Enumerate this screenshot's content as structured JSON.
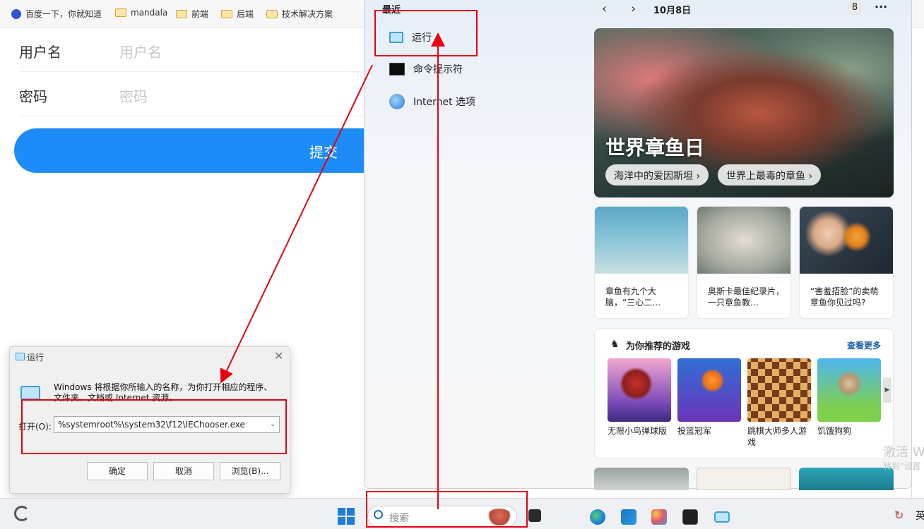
{
  "bookmarks": [
    {
      "label": "百度一下，你就知道",
      "icon": "baidu-paw-icon"
    },
    {
      "label": "mandala",
      "icon": "folder-icon"
    },
    {
      "label": "前端",
      "icon": "folder-icon"
    },
    {
      "label": "后端",
      "icon": "folder-icon"
    },
    {
      "label": "技术解决方案",
      "icon": "folder-icon"
    }
  ],
  "login_form": {
    "username_label": "用户名",
    "username_placeholder": "用户名",
    "password_label": "密码",
    "password_placeholder": "密码",
    "submit_label": "提交",
    "submit_color": "#1e8cf8"
  },
  "start_panel": {
    "recent_title": "最近",
    "recent_items": [
      {
        "label": "运行",
        "icon": "run-icon"
      },
      {
        "label": "命令提示符",
        "icon": "cmd-icon"
      },
      {
        "label": "Internet 选项",
        "icon": "internet-options-icon"
      }
    ],
    "date": "10月8日",
    "badge": "8",
    "more": "···",
    "hero": {
      "title": "世界章鱼日",
      "chips": [
        "海洋中的爱因斯坦 ›",
        "世界上最毒的章鱼 ›"
      ]
    },
    "cards": [
      {
        "text": "章鱼有九个大脑，“三心二…"
      },
      {
        "text": "奥斯卡最佳纪录片，一只章鱼教…"
      },
      {
        "text": "“害羞捂脸”的卖萌章鱼你见过吗?"
      }
    ],
    "games": {
      "title": "为你推荐的游戏",
      "see_more": "查看更多",
      "items": [
        {
          "name": "无限小鸟弹球版"
        },
        {
          "name": "投篮冠军"
        },
        {
          "name": "跳棋大师多人游戏"
        },
        {
          "name": "饥饿狗狗"
        }
      ]
    }
  },
  "run_dialog": {
    "title": "运行",
    "message": "Windows 将根据你所输入的名称，为你打开相应的程序、文件夹、文档或 Internet 资源。",
    "open_label": "打开(O):",
    "input_value": "%systemroot%\\system32\\f12\\IEChooser.exe",
    "ok_label": "确定",
    "cancel_label": "取消",
    "browse_label": "浏览(B)..."
  },
  "taskbar": {
    "search_placeholder": "搜索"
  },
  "watermark": {
    "line1": "激活 W",
    "line2": "转到\"设置"
  },
  "colors": {
    "annotation_red": "#e8000f",
    "accent_blue": "#1e7fd8"
  }
}
